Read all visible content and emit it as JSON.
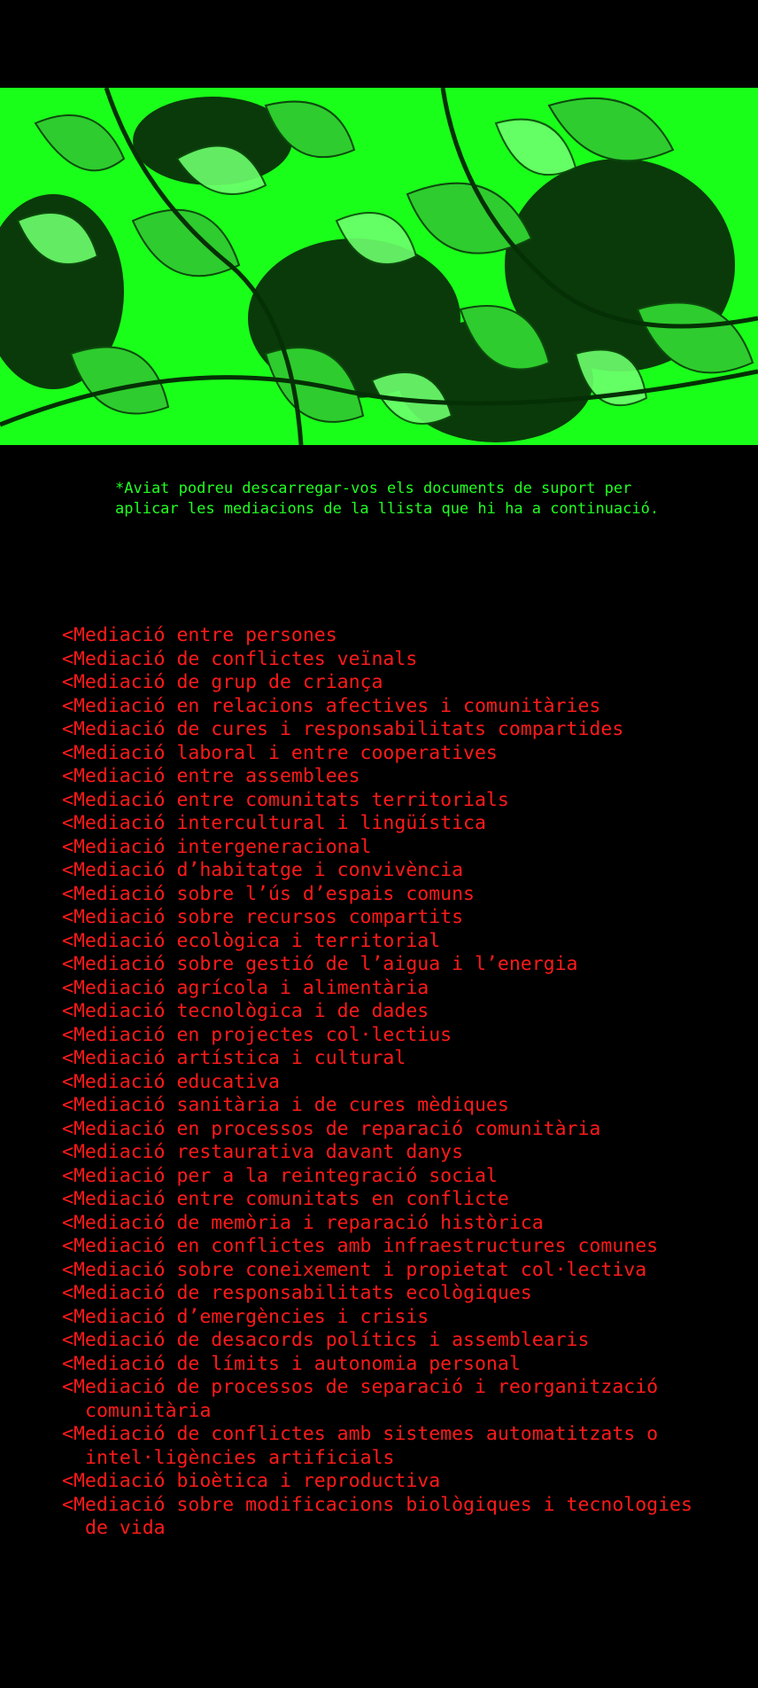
{
  "page": {
    "hero_image": "green-leaves-photo",
    "note": "*Aviat podreu descarregar-vos els documents de suport per aplicar les mediacions de la llista que hi ha a continuació.",
    "mediations": [
      "<Mediació entre persones",
      "<Mediació de conflictes veïnals",
      "<Mediació de grup de criança",
      "<Mediació en relacions afectives i comunitàries",
      "<Mediació de cures i responsabilitats compartides",
      "<Mediació laboral i entre cooperatives",
      "<Mediació entre assemblees",
      "<Mediació entre comunitats territorials",
      "<Mediació intercultural i lingüística",
      "<Mediació intergeneracional",
      "<Mediació d’habitatge i convivència",
      "<Mediació sobre l’ús d’espais comuns",
      "<Mediació sobre recursos compartits",
      "<Mediació ecològica i territorial",
      "<Mediació sobre gestió de l’aigua i l’energia",
      "<Mediació agrícola i alimentària",
      "<Mediació tecnològica i de dades",
      "<Mediació en projectes col·lectius",
      "<Mediació artística i cultural",
      "<Mediació educativa",
      "<Mediació sanitària i de cures mèdiques",
      "<Mediació en processos de reparació comunitària",
      "<Mediació restaurativa davant danys",
      "<Mediació per a la reintegració social",
      "<Mediació entre comunitats en conflicte",
      "<Mediació de memòria i reparació històrica",
      "<Mediació en conflictes amb infraestructures comunes",
      "<Mediació sobre coneixement i propietat col·lectiva",
      "<Mediació de responsabilitats ecològiques",
      "<Mediació d’emergències i crisis",
      "<Mediació de desacords polítics i assemblearis",
      "<Mediació de límits i autonomia personal",
      "<Mediació de processos de separació i reorganització comunitària",
      "<Mediació de conflictes amb sistemes automatitzats o intel·ligències artificials",
      "<Mediació bioètica i reproductiva",
      "<Mediació sobre modificacions biològiques i tecnologies de vida"
    ]
  },
  "colors": {
    "background": "#000000",
    "hero_green": "#1aff1a",
    "note_text": "#22ff22",
    "list_text": "#ff1a1a"
  }
}
